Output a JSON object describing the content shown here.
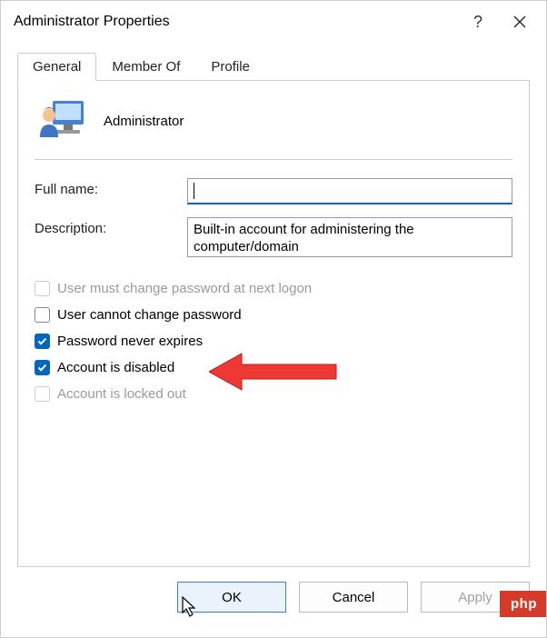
{
  "title": "Administrator Properties",
  "tabs": {
    "general": "General",
    "memberof": "Member Of",
    "profile": "Profile"
  },
  "header": {
    "username": "Administrator"
  },
  "fields": {
    "fullname_label": "Full name:",
    "fullname_value": "",
    "description_label": "Description:",
    "description_value": "Built-in account for administering the computer/domain"
  },
  "checks": {
    "must_change": {
      "label": "User must change password at next logon",
      "checked": false,
      "enabled": false
    },
    "cannot_change": {
      "label": "User cannot change password",
      "checked": false,
      "enabled": true
    },
    "never_expires": {
      "label": "Password never expires",
      "checked": true,
      "enabled": true
    },
    "disabled": {
      "label": "Account is disabled",
      "checked": true,
      "enabled": true
    },
    "locked_out": {
      "label": "Account is locked out",
      "checked": false,
      "enabled": false
    }
  },
  "buttons": {
    "ok": "OK",
    "cancel": "Cancel",
    "apply": "Apply"
  },
  "watermark": "php"
}
